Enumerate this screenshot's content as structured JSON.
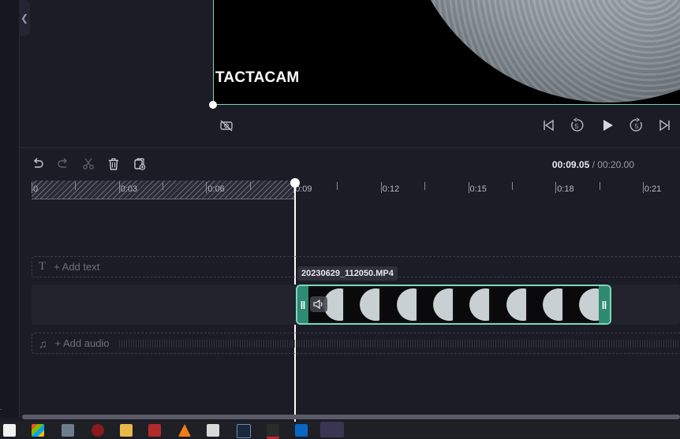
{
  "preview": {
    "watermark": "TACTACAM"
  },
  "player": {
    "icons": [
      "no-camera-icon",
      "skip-back-icon",
      "rewind-5-icon",
      "play-icon",
      "forward-5-icon",
      "skip-forward-icon"
    ],
    "rewind_label": "5",
    "forward_label": "5"
  },
  "toolbar": {
    "current_time": "00:09.05",
    "total_time": "/ 00:20.00"
  },
  "ruler": {
    "labels": [
      "0",
      "0:03",
      "0:06",
      "0:09",
      "0:12",
      "0:15",
      "0:18",
      "0:21"
    ]
  },
  "tracks": {
    "text_label": "+ Add text",
    "audio_label": "+ Add audio"
  },
  "clip": {
    "name": "20230629_112050.MP4"
  },
  "colors": {
    "accent": "#7fd6b9",
    "clip_handle": "#2f8a72",
    "background": "#1b1c25"
  }
}
